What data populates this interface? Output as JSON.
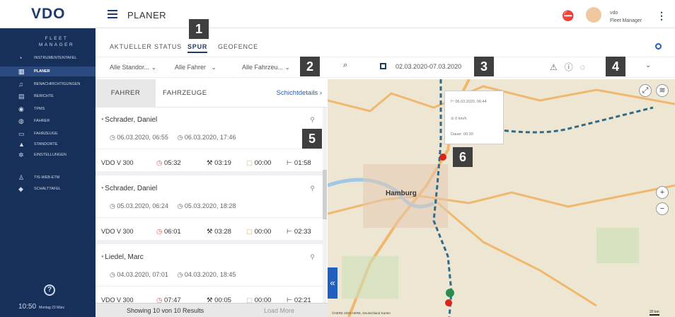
{
  "app": {
    "logo": "VDO",
    "section": "PLANER",
    "user_name": "vdo",
    "user_role": "Fleet Manager"
  },
  "sidebar": {
    "title_line1": "FLEET",
    "title_line2": "MANAGER",
    "items": [
      {
        "label": "INSTRUMENTENTAFEL",
        "icon": "dashboard-icon",
        "glyph": "◔"
      },
      {
        "label": "PLANER",
        "icon": "planner-icon",
        "glyph": "▥"
      },
      {
        "label": "BENACHRICHTIGUNGEN",
        "icon": "bell-icon",
        "glyph": "♫"
      },
      {
        "label": "BERICHTE",
        "icon": "report-icon",
        "glyph": "▤"
      },
      {
        "label": "TPMS",
        "icon": "tire-icon",
        "glyph": "◉"
      },
      {
        "label": "FAHRER",
        "icon": "driver-icon",
        "glyph": "◍"
      },
      {
        "label": "FAHRZEUGE",
        "icon": "truck-icon",
        "glyph": "▭"
      },
      {
        "label": "STANDORTE",
        "icon": "locations-icon",
        "glyph": "▲"
      },
      {
        "label": "EINSTELLUNGEN",
        "icon": "settings-icon",
        "glyph": "✲"
      },
      {
        "label": "TIS-WEB-ETM",
        "icon": "user-icon",
        "glyph": "♙"
      },
      {
        "label": "SCHALTTAFEL",
        "icon": "car-icon",
        "glyph": "◆"
      }
    ],
    "time": "10:50",
    "date": "Montag 23 März"
  },
  "tabs": [
    "AKTUELLER STATUS",
    "SPUR",
    "GEOFENCE"
  ],
  "filters": {
    "location": "Alle Standor...",
    "driver": "Alle Fahrer",
    "vehicle": "Alle Fahrzeu...",
    "date_range": "02.03.2020-07.03.2020"
  },
  "panel": {
    "tab_drivers": "FAHRER",
    "tab_vehicles": "FAHRZEUGE",
    "shift_details": "Schichtdetails",
    "footer": "Showing 10 von 10 Results",
    "load_more": "Load More"
  },
  "entries": [
    {
      "driver": "Schrader, Daniel",
      "start": "06.03.2020, 06:55",
      "end": "06.03.2020, 17:46",
      "vehicle": "VDO V 300",
      "s1": "05:32",
      "s2": "03:19",
      "s3": "00:00",
      "s4": "01:58"
    },
    {
      "driver": "Schrader, Daniel",
      "start": "05.03.2020, 06:24",
      "end": "05.03.2020, 18:28",
      "vehicle": "VDO V 300",
      "s1": "06:01",
      "s2": "03:28",
      "s3": "00:00",
      "s4": "02:33"
    },
    {
      "driver": "Liedel, Marc",
      "start": "04.03.2020, 07:01",
      "end": "04.03.2020, 18:45",
      "vehicle": "VDO V 300",
      "s1": "07:47",
      "s2": "00:05",
      "s3": "00:00",
      "s4": "02:21"
    }
  ],
  "map": {
    "city": "Hamburg",
    "attribution": "©HERE 2020 HERE, Deutschland Karten",
    "scale": "20 km",
    "popup_time": "06.03.2020, 06:44",
    "popup_speed": "0 km/h",
    "popup_duration": "Dauer: 00:30"
  },
  "badges": [
    "1",
    "2",
    "3",
    "4",
    "5",
    "6"
  ],
  "colors": {
    "sidebar": "#17305a",
    "accent": "#1e5fbf",
    "badge": "#3f3f3f"
  }
}
